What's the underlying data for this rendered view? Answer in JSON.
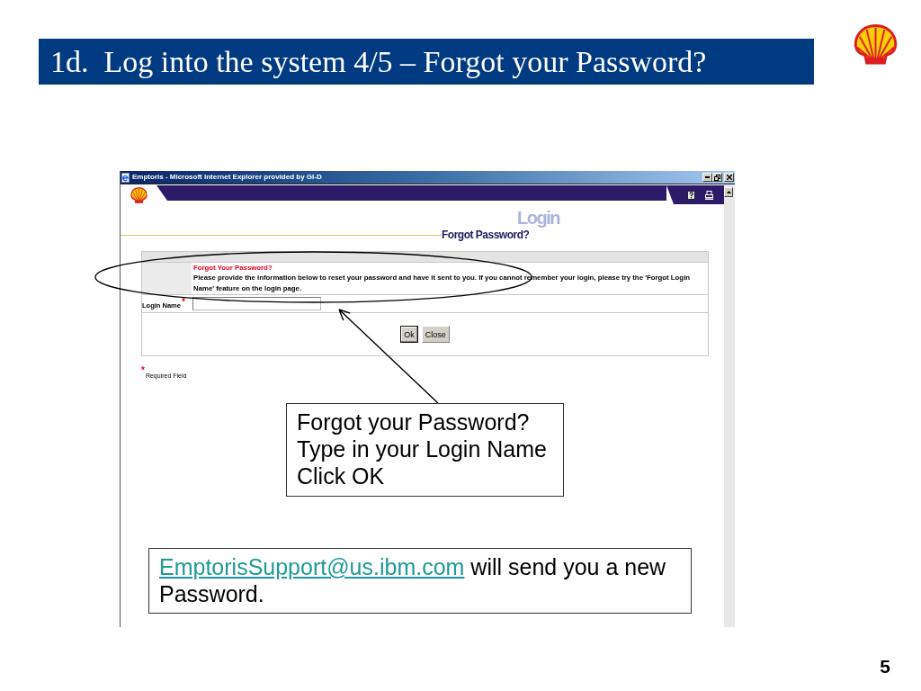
{
  "slide": {
    "title": "1d.  Log into the system 4/5 – Forgot your Password?",
    "page_number": "5"
  },
  "browser": {
    "title": "Emptoris - Microsoft Internet Explorer provided by GI-D"
  },
  "app": {
    "section": "Login",
    "page_title": "Forgot Password?"
  },
  "form": {
    "message_title": "Forgot Your Password?",
    "message": "Please provide the information below to reset your password and have it sent to you. If you cannot remember your login, please try the 'Forgot Login Name' feature on the login page.",
    "fields": [
      {
        "label": "Login Name",
        "required_mark": "*"
      }
    ],
    "buttons": [
      {
        "label": "Ok",
        "default": true
      },
      {
        "label": "Close",
        "default": false
      }
    ]
  },
  "required_note": {
    "mark": "*",
    "text": "Required Field"
  },
  "callouts": [
    {
      "kind": "steps",
      "lines": [
        "Forgot your Password?",
        "Type in your Login Name",
        "Click OK"
      ]
    },
    {
      "kind": "contact",
      "link": "EmptorisSupport@us.ibm.com",
      "text": "will send you a new Password."
    }
  ]
}
